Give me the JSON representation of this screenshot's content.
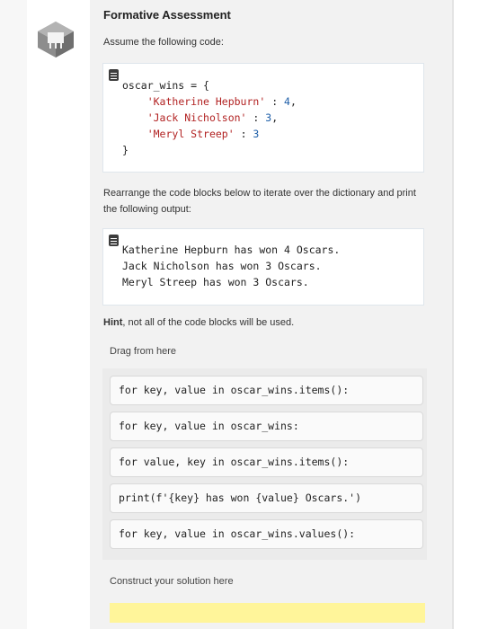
{
  "header": {
    "title": "Formative Assessment"
  },
  "intro": "Assume the following code:",
  "code_listing": {
    "l1": "oscar_wins = {",
    "l2_key": "'Katherine Hepburn'",
    "l2_rest": " : ",
    "l2_val": "4",
    "l2_end": ",",
    "l3_key": "'Jack Nicholson'",
    "l3_rest": " : ",
    "l3_val": "3",
    "l3_end": ",",
    "l4_key": "'Meryl Streep'",
    "l4_rest": " : ",
    "l4_val": "3",
    "l5": "}"
  },
  "instruction": "Rearrange the code blocks below to iterate over the dictionary and print the following output:",
  "output_listing": [
    "Katherine Hepburn has won 4 Oscars.",
    "Jack Nicholson has won 3 Oscars.",
    "Meryl Streep has won 3 Oscars."
  ],
  "hint": {
    "bold": "Hint",
    "rest": ", not all of the code blocks will be used."
  },
  "drag_label": "Drag from here",
  "blocks": [
    "for key, value in oscar_wins.items():",
    "for key, value in oscar_wins:",
    "for value, key in oscar_wins.items():",
    "print(f'{key} has won {value} Oscars.')",
    "for key, value in oscar_wins.values():"
  ],
  "construct_label": "Construct your solution here",
  "colors": {
    "dropzone": "#fff59a",
    "string": "#b22222",
    "number": "#1d5ea8"
  },
  "icons": [
    "logo-icon",
    "document-icon"
  ]
}
